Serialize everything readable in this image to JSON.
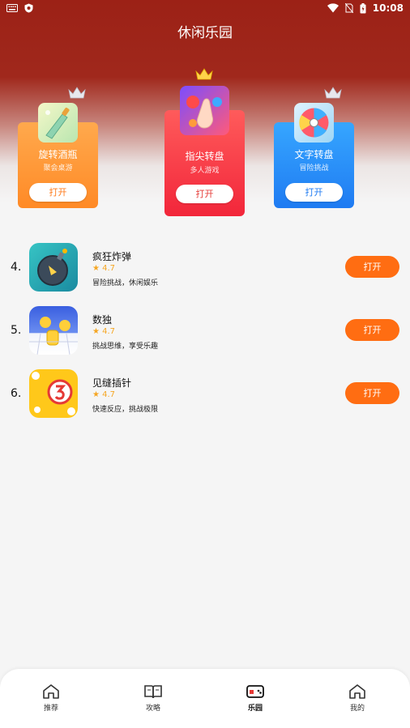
{
  "status_bar": {
    "time": "10:08"
  },
  "header": {
    "title": "休闲乐园"
  },
  "top_games": [
    {
      "name": "旋转酒瓶",
      "subtitle": "聚会桌游",
      "button": "打开"
    },
    {
      "name": "指尖转盘",
      "subtitle": "多人游戏",
      "button": "打开"
    },
    {
      "name": "文字转盘",
      "subtitle": "冒险挑战",
      "button": "打开"
    }
  ],
  "game_list": [
    {
      "rank": "4.",
      "name": "疯狂炸弹",
      "rating": "★ 4.7",
      "desc": "冒险挑战，休闲娱乐",
      "button": "打开"
    },
    {
      "rank": "5.",
      "name": "数独",
      "rating": "★ 4.7",
      "desc": "挑战思维，享受乐趣",
      "button": "打开"
    },
    {
      "rank": "6.",
      "name": "见缝插针",
      "rating": "★ 4.7",
      "desc": "快速反应，挑战极限",
      "button": "打开"
    }
  ],
  "bottom_nav": [
    {
      "label": "推荐",
      "icon": "home-icon"
    },
    {
      "label": "攻略",
      "icon": "book-icon"
    },
    {
      "label": "乐园",
      "icon": "gamepad-icon",
      "active": true
    },
    {
      "label": "我的",
      "icon": "profile-home-icon"
    }
  ],
  "colors": {
    "header_red": "#9c2116",
    "open_button": "#ff6d12",
    "card_orange": "#ff8a26",
    "card_red": "#f2263a",
    "card_blue": "#1f7bf2"
  }
}
